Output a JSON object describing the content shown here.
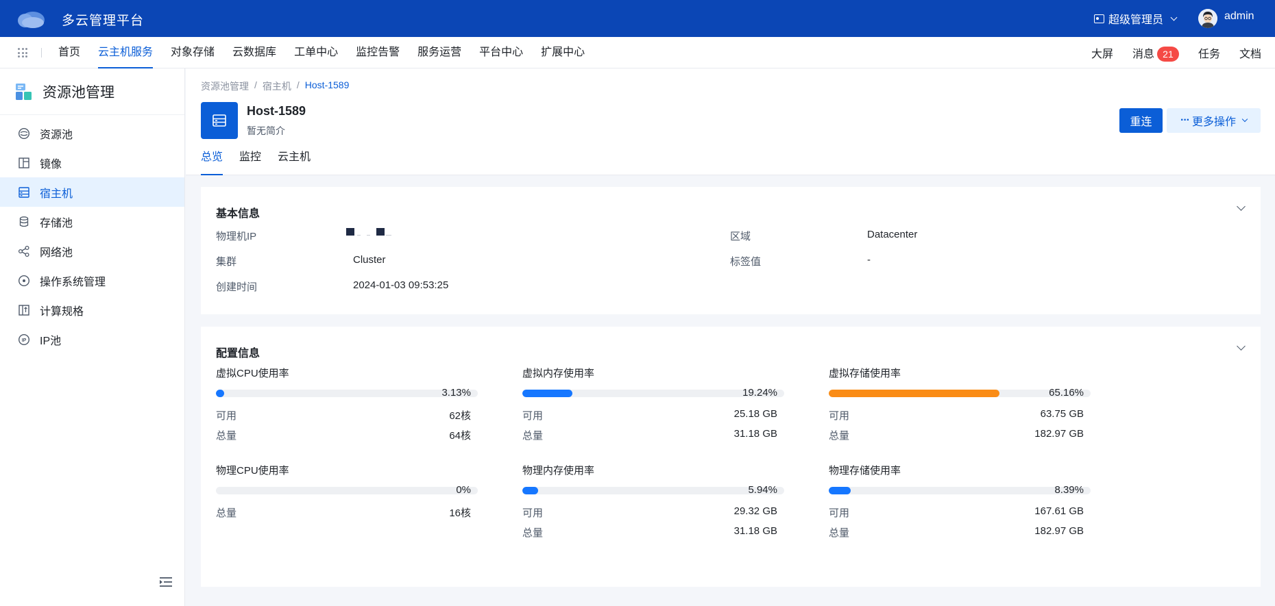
{
  "app": {
    "title": "多云管理平台",
    "role": "超级管理员",
    "user": "admin"
  },
  "nav": {
    "items": [
      "首页",
      "云主机服务",
      "对象存储",
      "云数据库",
      "工单中心",
      "监控告警",
      "服务运营",
      "平台中心",
      "扩展中心"
    ],
    "active": "云主机服务",
    "right": {
      "screen": "大屏",
      "messages": "消息",
      "message_count": "21",
      "tasks": "任务",
      "docs": "文档"
    }
  },
  "sidebar": {
    "title": "资源池管理",
    "items": [
      {
        "label": "资源池",
        "icon": "resource-pool-icon"
      },
      {
        "label": "镜像",
        "icon": "image-icon"
      },
      {
        "label": "宿主机",
        "icon": "host-icon",
        "active": true
      },
      {
        "label": "存储池",
        "icon": "database-icon"
      },
      {
        "label": "网络池",
        "icon": "network-icon"
      },
      {
        "label": "操作系统管理",
        "icon": "disc-icon"
      },
      {
        "label": "计算规格",
        "icon": "spec-icon"
      },
      {
        "label": "IP池",
        "icon": "ip-icon"
      }
    ]
  },
  "breadcrumb": [
    "资源池管理",
    "宿主机",
    "Host-1589"
  ],
  "host": {
    "name": "Host-1589",
    "desc": "暂无简介"
  },
  "actions": {
    "reconnect": "重连",
    "more": "更多操作"
  },
  "tabs": [
    "总览",
    "监控",
    "云主机"
  ],
  "basic": {
    "title": "基本信息",
    "physical_ip_label": "物理机IP",
    "region_label": "区域",
    "region_value": "Datacenter",
    "cluster_label": "集群",
    "cluster_value": "Cluster",
    "tag_label": "标签值",
    "tag_value": "-",
    "created_label": "创建时间",
    "created_value": "2024-01-03 09:53:25"
  },
  "config": {
    "title": "配置信息",
    "metrics": [
      {
        "title": "虚拟CPU使用率",
        "percent": "3.13%",
        "fraction": 0.0313,
        "color": "#1677ff",
        "rows": [
          [
            "可用",
            "62核"
          ],
          [
            "总量",
            "64核"
          ]
        ]
      },
      {
        "title": "虚拟内存使用率",
        "percent": "19.24%",
        "fraction": 0.1924,
        "color": "#1677ff",
        "rows": [
          [
            "可用",
            "25.18 GB"
          ],
          [
            "总量",
            "31.18 GB"
          ]
        ]
      },
      {
        "title": "虚拟存储使用率",
        "percent": "65.16%",
        "fraction": 0.6516,
        "color": "#fa8c16",
        "rows": [
          [
            "可用",
            "63.75 GB"
          ],
          [
            "总量",
            "182.97 GB"
          ]
        ]
      },
      {
        "title": "物理CPU使用率",
        "percent": "0%",
        "fraction": 0,
        "color": "#1677ff",
        "rows": [
          [
            "总量",
            "16核"
          ]
        ]
      },
      {
        "title": "物理内存使用率",
        "percent": "5.94%",
        "fraction": 0.0594,
        "color": "#1677ff",
        "rows": [
          [
            "可用",
            "29.32 GB"
          ],
          [
            "总量",
            "31.18 GB"
          ]
        ]
      },
      {
        "title": "物理存储使用率",
        "percent": "8.39%",
        "fraction": 0.0839,
        "color": "#1677ff",
        "rows": [
          [
            "可用",
            "167.61 GB"
          ],
          [
            "总量",
            "182.97 GB"
          ]
        ]
      }
    ]
  },
  "colors": {
    "brand": "#0b46b5",
    "accent": "#0b5ed7",
    "warning": "#fa8c16",
    "badge": "#f54a45"
  }
}
